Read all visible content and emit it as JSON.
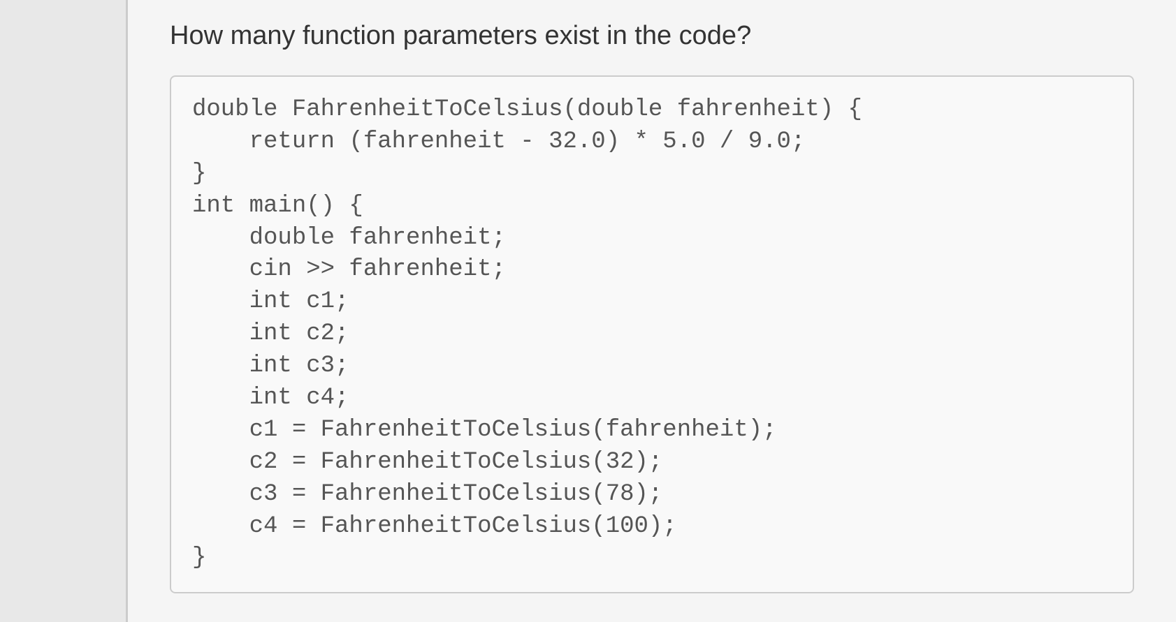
{
  "question": "How many function parameters exist in the code?",
  "code": {
    "line1": "double FahrenheitToCelsius(double fahrenheit) {",
    "line2": "    return (fahrenheit - 32.0) * 5.0 / 9.0;",
    "line3": "}",
    "line4": "int main() {",
    "line5": "    double fahrenheit;",
    "line6": "    cin >> fahrenheit;",
    "line7": "    int c1;",
    "line8": "    int c2;",
    "line9": "    int c3;",
    "line10": "    int c4;",
    "line11": "    c1 = FahrenheitToCelsius(fahrenheit);",
    "line12": "    c2 = FahrenheitToCelsius(32);",
    "line13": "    c3 = FahrenheitToCelsius(78);",
    "line14": "    c4 = FahrenheitToCelsius(100);",
    "line15": "}"
  }
}
